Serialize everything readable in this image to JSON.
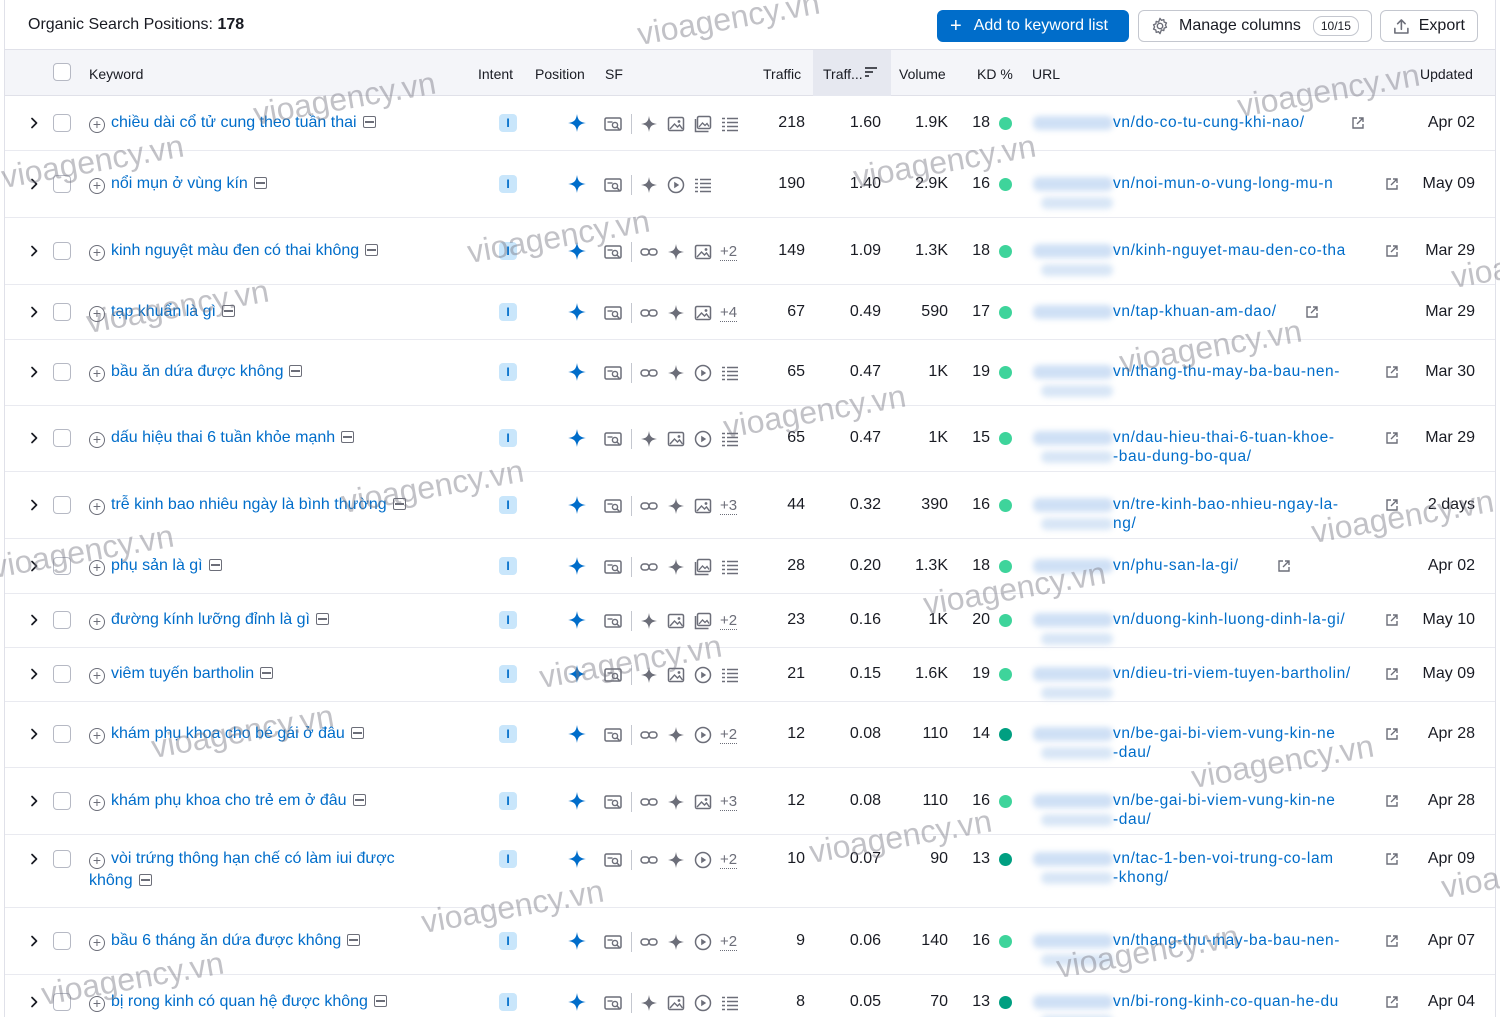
{
  "toolbar": {
    "title_prefix": "Organic Search Positions:",
    "title_count": "178",
    "add_label": "Add to keyword list",
    "manage_label": "Manage columns",
    "manage_count": "10/15",
    "export_label": "Export"
  },
  "columns": {
    "keyword": "Keyword",
    "intent": "Intent",
    "position": "Position",
    "sf": "SF",
    "traffic": "Traffic",
    "traffic_pct": "Traff...",
    "volume": "Volume",
    "kd": "KD %",
    "url": "URL",
    "updated": "Updated"
  },
  "watermark": "vioagency.vn",
  "colors": {
    "accent": "#006dca",
    "kd_light": "#3ed49b",
    "kd_dark": "#009f81",
    "intent_bg": "#c9e6fb"
  },
  "rows": [
    {
      "keyword": "chiều dài cổ tử cung theo tuần thai",
      "intent": "I",
      "traffic": "218",
      "traffic_pct": "1.60",
      "volume": "1.9K",
      "kd": "18",
      "url": "vn/do-co-tu-cung-khi-nao/",
      "updated": "Apr 02",
      "sf_more": ""
    },
    {
      "keyword": "nổi mụn ở vùng kín",
      "intent": "I",
      "traffic": "190",
      "traffic_pct": "1.40",
      "volume": "2.9K",
      "kd": "16",
      "url": "vn/noi-mun-o-vung-long-mu-n",
      "updated": "May 09",
      "sf_more": ""
    },
    {
      "keyword": "kinh nguyệt màu đen có thai không",
      "intent": "I",
      "traffic": "149",
      "traffic_pct": "1.09",
      "volume": "1.3K",
      "kd": "18",
      "url": "vn/kinh-nguyet-mau-den-co-tha",
      "updated": "Mar 29",
      "sf_more": "+2"
    },
    {
      "keyword": "tạp khuẩn là gì",
      "intent": "I",
      "traffic": "67",
      "traffic_pct": "0.49",
      "volume": "590",
      "kd": "17",
      "url": "vn/tap-khuan-am-dao/",
      "updated": "Mar 29",
      "sf_more": "+4"
    },
    {
      "keyword": "bầu ăn dứa được không",
      "intent": "I",
      "traffic": "65",
      "traffic_pct": "0.47",
      "volume": "1K",
      "kd": "19",
      "url": "vn/thang-thu-may-ba-bau-nen-",
      "updated": "Mar 30",
      "sf_more": ""
    },
    {
      "keyword": "dấu hiệu thai 6 tuần khỏe mạnh",
      "intent": "I",
      "traffic": "65",
      "traffic_pct": "0.47",
      "volume": "1K",
      "kd": "15",
      "url": "vn/dau-hieu-thai-6-tuan-khoe-",
      "url2": "-bau-dung-bo-qua/",
      "updated": "Mar 29",
      "sf_more": ""
    },
    {
      "keyword": "trễ kinh bao nhiêu ngày là bình thường",
      "intent": "I",
      "traffic": "44",
      "traffic_pct": "0.32",
      "volume": "390",
      "kd": "16",
      "url": "vn/tre-kinh-bao-nhieu-ngay-la-",
      "url2": "ng/",
      "updated": "2 days",
      "sf_more": "+3"
    },
    {
      "keyword": "phụ sản là gì",
      "intent": "I",
      "traffic": "28",
      "traffic_pct": "0.20",
      "volume": "1.3K",
      "kd": "18",
      "url": "vn/phu-san-la-gi/",
      "updated": "Apr 02",
      "sf_more": ""
    },
    {
      "keyword": "đường kính lưỡng đỉnh là gì",
      "intent": "I",
      "traffic": "23",
      "traffic_pct": "0.16",
      "volume": "1K",
      "kd": "20",
      "url": "vn/duong-kinh-luong-dinh-la-gi/",
      "updated": "May 10",
      "sf_more": "+2"
    },
    {
      "keyword": "viêm tuyến bartholin",
      "intent": "I",
      "traffic": "21",
      "traffic_pct": "0.15",
      "volume": "1.6K",
      "kd": "19",
      "url": "vn/dieu-tri-viem-tuyen-bartholin/",
      "updated": "May 09",
      "sf_more": ""
    },
    {
      "keyword": "khám phụ khoa cho bé gái ở đâu",
      "intent": "I",
      "traffic": "12",
      "traffic_pct": "0.08",
      "volume": "110",
      "kd": "14",
      "url": "vn/be-gai-bi-viem-vung-kin-ne",
      "url2": "-dau/",
      "updated": "Apr 28",
      "sf_more": "+2"
    },
    {
      "keyword": "khám phụ khoa cho trẻ em ở đâu",
      "intent": "I",
      "traffic": "12",
      "traffic_pct": "0.08",
      "volume": "110",
      "kd": "16",
      "url": "vn/be-gai-bi-viem-vung-kin-ne",
      "url2": "-dau/",
      "updated": "Apr 28",
      "sf_more": "+3"
    },
    {
      "keyword": "vòi trứng thông hạn chế có làm iui được không",
      "intent": "I",
      "traffic": "10",
      "traffic_pct": "0.07",
      "volume": "90",
      "kd": "13",
      "url": "vn/tac-1-ben-voi-trung-co-lam",
      "url2": "-khong/",
      "updated": "Apr 09",
      "sf_more": "+2"
    },
    {
      "keyword": "bầu 6 tháng ăn dứa được không",
      "intent": "I",
      "traffic": "9",
      "traffic_pct": "0.06",
      "volume": "140",
      "kd": "16",
      "url": "vn/thang-thu-may-ba-bau-nen-",
      "updated": "Apr 07",
      "sf_more": "+2"
    },
    {
      "keyword": "bị rong kinh có quan hệ được không",
      "intent": "I",
      "traffic": "8",
      "traffic_pct": "0.05",
      "volume": "70",
      "kd": "13",
      "url": "vn/bi-rong-kinh-co-quan-he-du",
      "updated": "Apr 04",
      "sf_more": ""
    }
  ]
}
